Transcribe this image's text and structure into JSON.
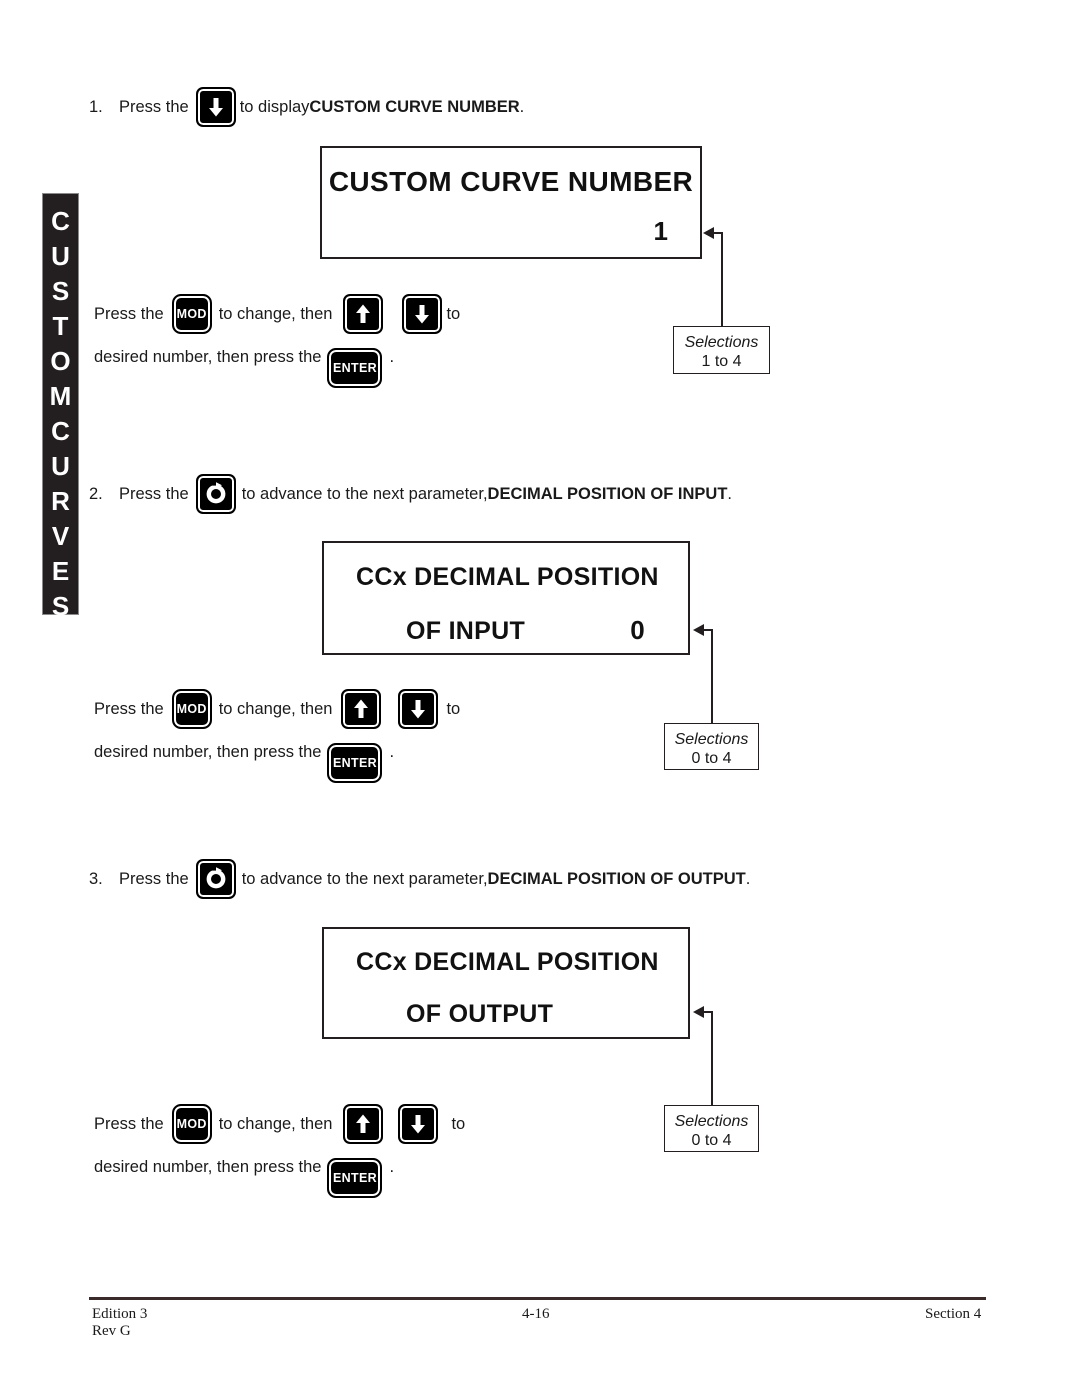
{
  "side_tab": {
    "name": "custom-curves-tab",
    "letters_top": [
      "C",
      "U",
      "S",
      "T",
      "O",
      "M"
    ],
    "letters_bottom": [
      "C",
      "U",
      "R",
      "V",
      "E",
      "S"
    ],
    "text": "CUSTOM CURVES"
  },
  "steps": [
    {
      "number": "1.",
      "before": "Press the",
      "icon": "down-arrow-key",
      "after_plain": "to display ",
      "after_bold": "CUSTOM CURVE NUMBER",
      "period": "."
    },
    {
      "number": "2.",
      "before": "Press the",
      "icon": "cycle-key",
      "after_plain": "to advance to the next parameter, ",
      "after_bold": "DECIMAL POSITION OF INPUT",
      "period": "."
    },
    {
      "number": "3.",
      "before": "Press the",
      "icon": "cycle-key",
      "after_plain": "to advance to the next parameter, ",
      "after_bold": "DECIMAL POSITION OF OUTPUT",
      "period": "."
    }
  ],
  "displays": [
    {
      "id": "custom-curve-number-display",
      "line1": "CUSTOM CURVE NUMBER",
      "line2": "",
      "value": "1",
      "layout": "centered-title"
    },
    {
      "id": "ccx-decimal-position-of-input-display",
      "line1": "CCx DECIMAL POSITION",
      "line2": "OF INPUT",
      "value": "0",
      "layout": "two-line"
    },
    {
      "id": "ccx-decimal-position-of-output-display",
      "line1": "CCx DECIMAL POSITION",
      "line2": "OF OUTPUT",
      "value": "",
      "layout": "two-line"
    }
  ],
  "selections": [
    {
      "title": "Selections",
      "range": "1 to 4"
    },
    {
      "title": "Selections",
      "range": "0 to 4"
    },
    {
      "title": "Selections",
      "range": "0 to 4"
    }
  ],
  "instructions": [
    {
      "press_the": "Press the",
      "mod_label": "MOD",
      "to_change": "to change, then",
      "up_icon": "up-arrow-key",
      "down_icon": "down-arrow-key",
      "to": "to",
      "desired": "desired number, then press the",
      "enter_label": "ENTER",
      "period": "."
    },
    {
      "press_the": "Press the",
      "mod_label": "MOD",
      "to_change": "to change, then",
      "up_icon": "up-arrow-key",
      "down_icon": "down-arrow-key",
      "to": "to",
      "desired": "desired number, then press the",
      "enter_label": "ENTER",
      "period": "."
    },
    {
      "press_the": "Press the",
      "mod_label": "MOD",
      "to_change": "to change, then",
      "up_icon": "up-arrow-key",
      "down_icon": "down-arrow-key",
      "to": "to",
      "desired": "desired number,  then press the",
      "enter_label": "ENTER",
      "period": "."
    }
  ],
  "footer": {
    "edition": "Edition 3",
    "rev": "Rev G",
    "page": "4-16",
    "section": "Section 4"
  },
  "colors": {
    "ink": "#231f20",
    "paper": "#ffffff"
  }
}
